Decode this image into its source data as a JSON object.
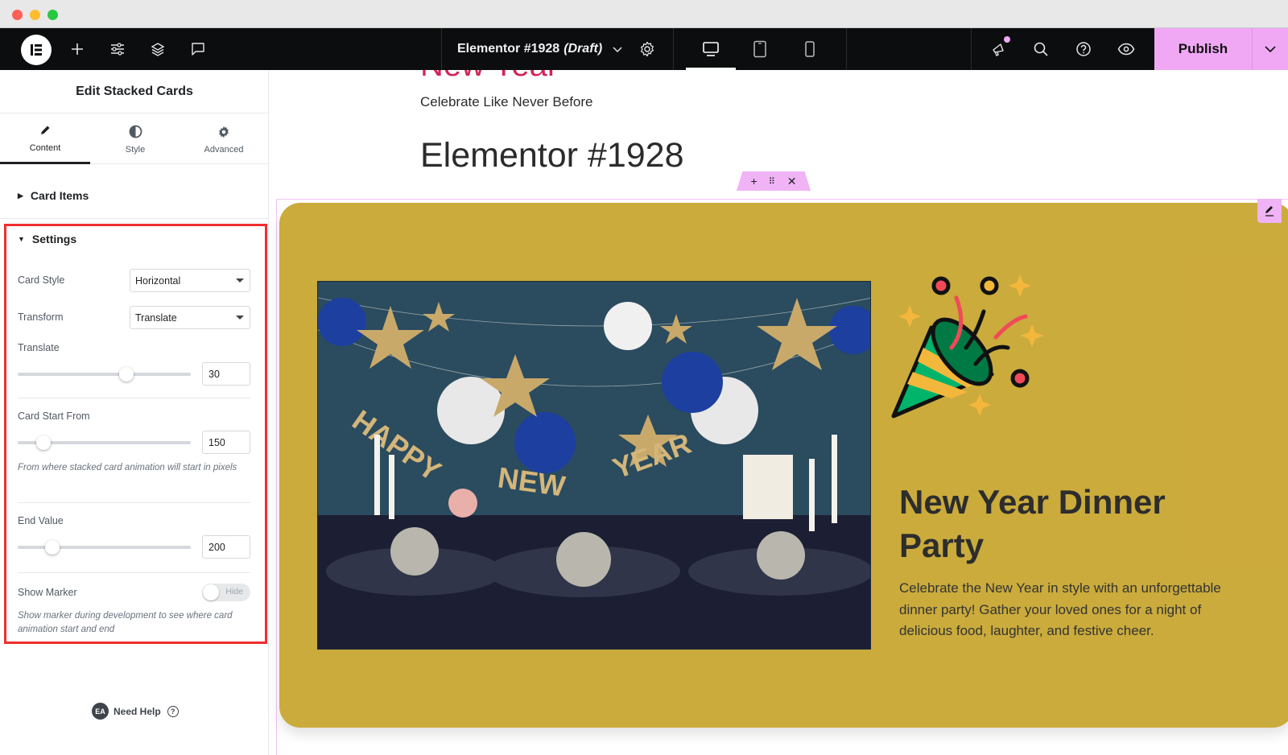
{
  "window": {
    "controls": [
      "close",
      "minimize",
      "maximize"
    ]
  },
  "topbar": {
    "logo_icon": "elementor-logo",
    "left_icons": [
      "plus-icon",
      "sliders-icon",
      "layers-icon",
      "comment-icon"
    ],
    "document_title": "Elementor #1928",
    "document_status": "(Draft)",
    "devices": [
      "desktop",
      "tablet",
      "mobile"
    ],
    "active_device": "desktop",
    "right_icons": [
      "megaphone-icon",
      "search-icon",
      "help-icon",
      "eye-icon"
    ],
    "publish_label": "Publish"
  },
  "panel": {
    "title": "Edit Stacked Cards",
    "tabs": [
      {
        "label": "Content",
        "icon": "pencil-icon",
        "active": true
      },
      {
        "label": "Style",
        "icon": "contrast-icon",
        "active": false
      },
      {
        "label": "Advanced",
        "icon": "gear-icon",
        "active": false
      }
    ],
    "sections": {
      "card_items": "Card Items",
      "settings": "Settings"
    },
    "settings": {
      "card_style": {
        "label": "Card Style",
        "value": "Horizontal"
      },
      "transform": {
        "label": "Transform",
        "value": "Translate"
      },
      "translate": {
        "label": "Translate",
        "value": "30",
        "slider_fraction": 0.63
      },
      "card_start_from": {
        "label": "Card Start From",
        "value": "150",
        "slider_fraction": 0.15,
        "description": "From where stacked card animation will start in pixels"
      },
      "end_value": {
        "label": "End Value",
        "value": "200",
        "slider_fraction": 0.2
      },
      "show_marker": {
        "label": "Show Marker",
        "toggle_text": "Hide",
        "on": false,
        "description": "Show marker during development to see where card animation start and end"
      }
    },
    "need_help": "Need Help",
    "ea_badge": "EA"
  },
  "canvas": {
    "partial_title": "New Year",
    "subtitle": "Celebrate Like Never Before",
    "page_heading": "Elementor #1928",
    "card": {
      "bg_color": "#caab3c",
      "heading": "New Year Dinner Party",
      "description": "Celebrate the New Year in style with an unforgettable dinner party! Gather your loved ones for a night of delicious food, laughter, and festive cheer.",
      "image_text": "HAPPY NEW YEAR",
      "icon": "party-popper-icon"
    }
  },
  "colors": {
    "accent_pink": "#f0a8f5",
    "highlight_red": "#f22e2e",
    "title_red": "#d3245a"
  }
}
